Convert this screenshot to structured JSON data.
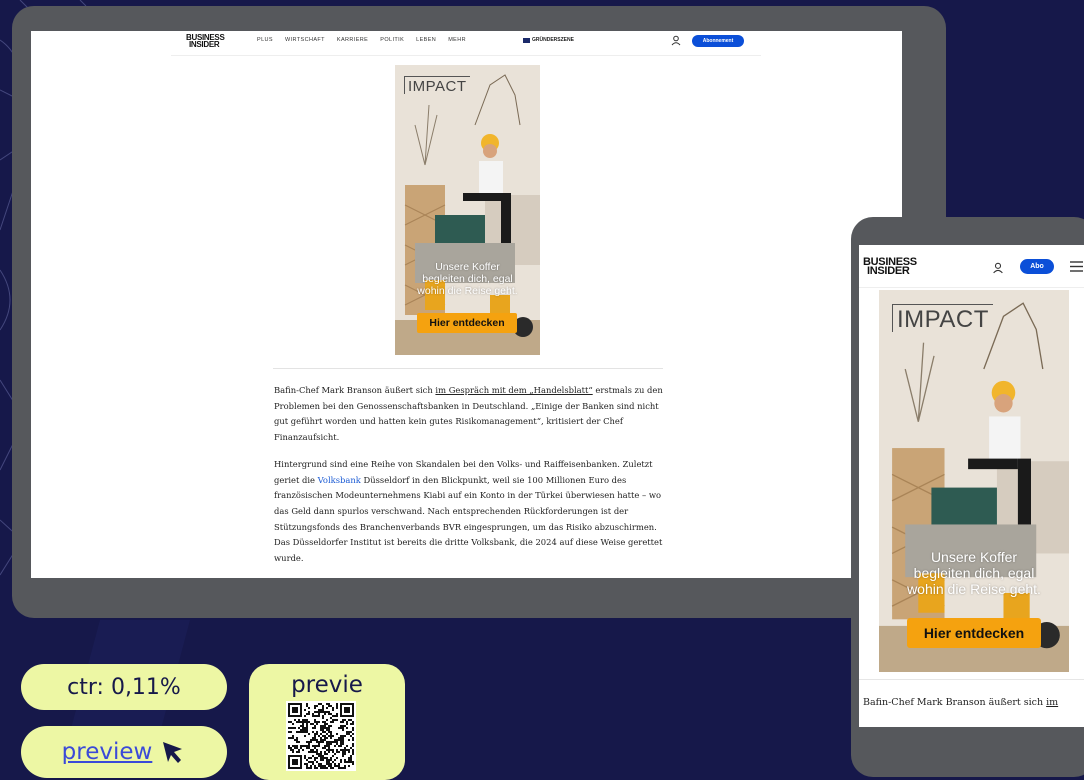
{
  "desktop": {
    "logo": [
      "BUSINESS",
      "INSIDER"
    ],
    "nav": [
      "PLUS",
      "WIRTSCHAFT",
      "KARRIERE",
      "POLITIK",
      "LEBEN",
      "MEHR"
    ],
    "gruender": "GRÜNDERSZENE",
    "abo_label": "Abonnement",
    "article": {
      "p1_a": "Bafin-Chef Mark Branson äußert sich ",
      "p1_link": "im Gespräch mit dem „Handelsblatt“",
      "p1_b": " erstmals zu den Problemen bei den Genossenschaftsbanken in Deutschland. „Einige der Banken sind nicht gut geführt worden und hatten kein gutes Risikomanagement“, kritisiert der Chef Finanzaufsicht.",
      "p2_a": "Hintergrund sind eine Reihe von Skandalen bei den Volks- und Raiffeisenbanken. Zuletzt geriet die ",
      "p2_link": "Volksbank",
      "p2_b": " Düsseldorf in den Blickpunkt, weil sie 100 Millionen Euro des französischen Modeunternehmens Kiabi auf ein Konto in der Türkei überwiesen hatte – wo das Geld dann spurlos verschwand. Nach entsprechenden Rückforderungen ist der Stützungsfonds des Branchenverbands BVR eingesprungen, um das Risiko abzuschirmen. Das Düsseldorfer Institut ist bereits die dritte Volksbank, die 2024 auf diese Weise gerettet wurde."
    }
  },
  "ad": {
    "brand": "IMPACT",
    "headline": [
      "Unsere Koffer",
      "begleiten dich, egal",
      "wohin die Reise geht."
    ],
    "cta": "Hier entdecken"
  },
  "mobile": {
    "logo": [
      "BUSINESS",
      "INSIDER"
    ],
    "abo_label": "Abo",
    "article_a": "Bafin-Chef Mark Branson äußert sich ",
    "article_link": "im"
  },
  "stats": {
    "ctr_label": "ctr: 0,11%",
    "preview_label": "preview",
    "qr_label": "previe"
  },
  "colors": {
    "background": "#16184a",
    "pill": "#edf7a4",
    "brand_blue": "#0b4fd8",
    "cta_orange": "#f5a20f"
  },
  "icons": [
    "user-icon",
    "menu-icon",
    "cursor-arrow-icon",
    "qr-code-icon"
  ]
}
